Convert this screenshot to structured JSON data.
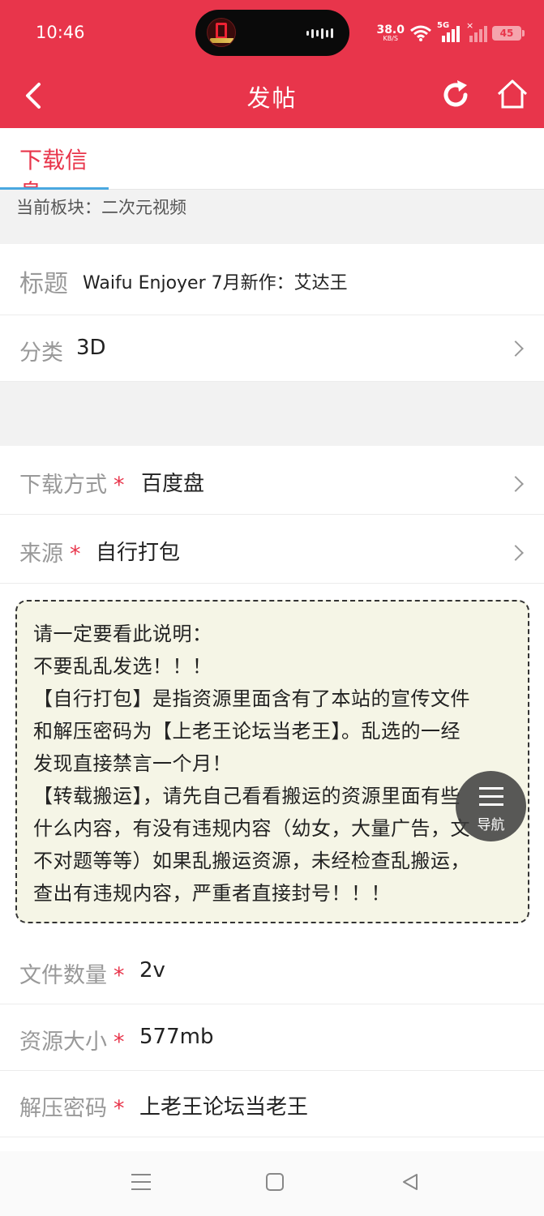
{
  "status_bar": {
    "time": "10:46",
    "net_speed_value": "38.0",
    "net_speed_unit": "KB/S",
    "network_type": "5G",
    "battery": "45"
  },
  "header": {
    "title": "发帖",
    "back_icon": "chevron-left-icon",
    "refresh_icon": "refresh-icon",
    "home_icon": "home-icon"
  },
  "tabs": [
    {
      "label": "下载信息",
      "active": true
    }
  ],
  "board": {
    "label": "当前板块：二次元视频"
  },
  "form": {
    "title": {
      "label": "标题",
      "value": "Waifu Enjoyer 7月新作：艾达王"
    },
    "category": {
      "label": "分类",
      "value": "3D"
    },
    "download_method": {
      "label": "下载方式",
      "required": "*",
      "value": "百度盘"
    },
    "source": {
      "label": "来源",
      "required": "*",
      "value": "自行打包"
    },
    "file_count": {
      "label": "文件数量",
      "required": "*",
      "value": "2v"
    },
    "resource_size": {
      "label": "资源大小",
      "required": "*",
      "value": "577mb"
    },
    "unzip_password": {
      "label": "解压密码",
      "required": "*",
      "value": "上老王论坛当老王"
    }
  },
  "notice": {
    "lines": [
      "请一定要看此说明：",
      "不要乱乱发选！！！",
      "【自行打包】是指资源里面含有了本站的宣传文件",
      "和解压密码为【上老王论坛当老王】。乱选的一经",
      "发现直接禁言一个月！",
      "【转载搬运】，请先自己看看搬运的资源里面有些",
      "什么内容，有没有违规内容（幼女，大量广告，文",
      "不对题等等）如果乱搬运资源，未经检查乱搬运，",
      "查出有违规内容，严重者直接封号！！！"
    ]
  },
  "fab": {
    "label": "导航",
    "icon": "menu-icon"
  },
  "colors": {
    "brand": "#e8354b",
    "tab_indicator": "#4aa8e0",
    "notice_bg": "#f5f5e6"
  }
}
